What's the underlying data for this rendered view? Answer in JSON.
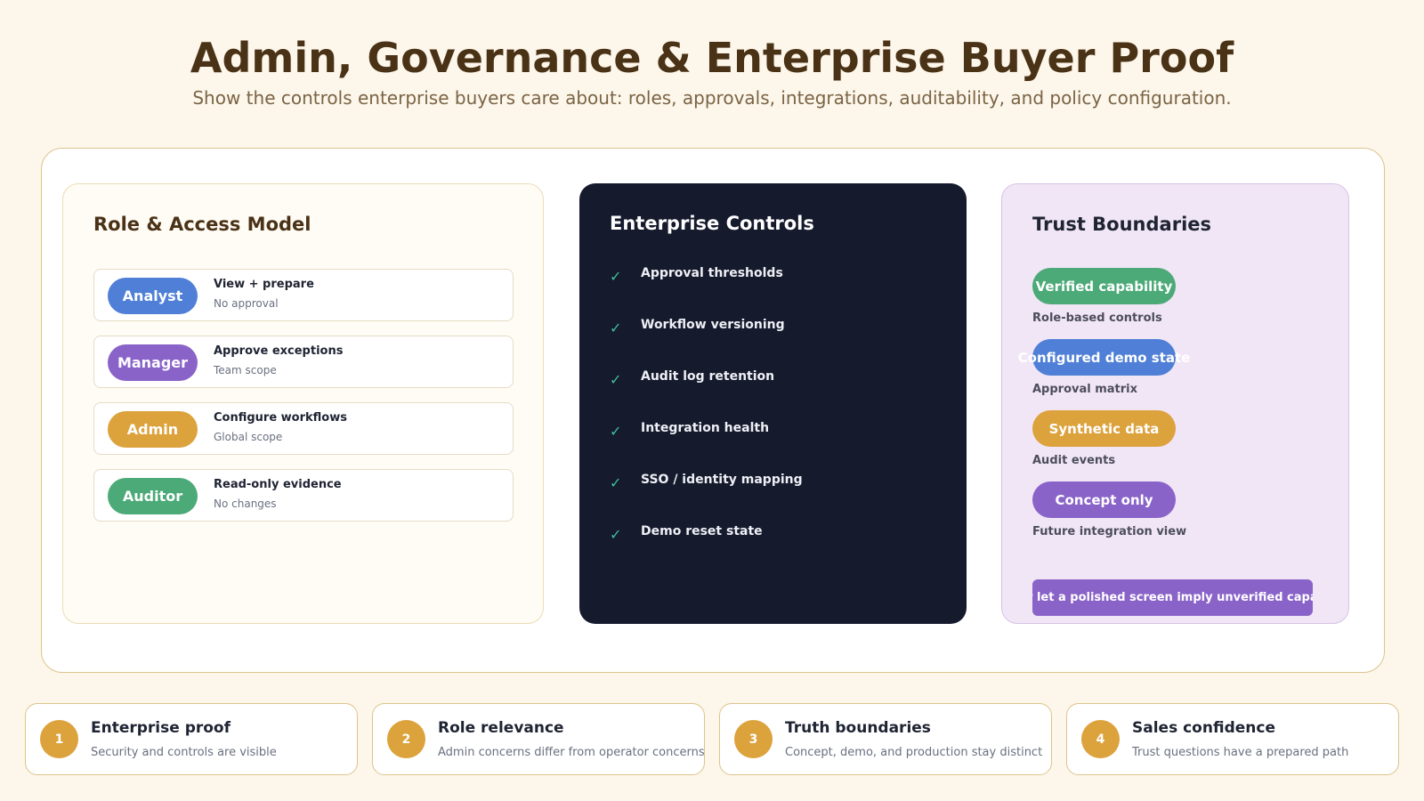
{
  "header": {
    "title": "Admin, Governance & Enterprise Buyer Proof",
    "subtitle": "Show the controls enterprise buyers care about: roles, approvals, integrations, auditability, and policy configuration."
  },
  "roles_panel": {
    "title": "Role & Access Model",
    "roles": [
      {
        "name": "Analyst",
        "action": "View + prepare",
        "scope": "No approval",
        "color": "#4f7fd6"
      },
      {
        "name": "Manager",
        "action": "Approve exceptions",
        "scope": "Team scope",
        "color": "#8a63c9"
      },
      {
        "name": "Admin",
        "action": "Configure workflows",
        "scope": "Global scope",
        "color": "#dca23c"
      },
      {
        "name": "Auditor",
        "action": "Read-only evidence",
        "scope": "No changes",
        "color": "#4caa78"
      }
    ]
  },
  "controls_panel": {
    "title": "Enterprise Controls",
    "check_icon": "check-icon",
    "items": [
      "Approval thresholds",
      "Workflow versioning",
      "Audit log retention",
      "Integration health",
      "SSO / identity mapping",
      "Demo reset state"
    ]
  },
  "trust_panel": {
    "title": "Trust Boundaries",
    "items": [
      {
        "label": "Verified capability",
        "desc": "Role-based controls",
        "color": "#4caa78"
      },
      {
        "label": "Configured demo state",
        "desc": "Approval matrix",
        "color": "#4f7fd6"
      },
      {
        "label": "Synthetic data",
        "desc": "Audit events",
        "color": "#dca23c"
      },
      {
        "label": "Concept only",
        "desc": "Future integration view",
        "color": "#8a63c9"
      }
    ],
    "banner": "Never let a polished screen imply unverified capability"
  },
  "cards": [
    {
      "num": "1",
      "title": "Enterprise proof",
      "desc": "Security and controls are visible"
    },
    {
      "num": "2",
      "title": "Role relevance",
      "desc": "Admin concerns differ from operator concerns"
    },
    {
      "num": "3",
      "title": "Truth boundaries",
      "desc": "Concept, demo, and production stay distinct"
    },
    {
      "num": "4",
      "title": "Sales confidence",
      "desc": "Trust questions have a prepared path"
    }
  ],
  "colors": {
    "background": "#fdf6ea",
    "accent_gold": "#dca23c",
    "dark_panel": "#151a2d",
    "check_green": "#3fbf9a"
  }
}
